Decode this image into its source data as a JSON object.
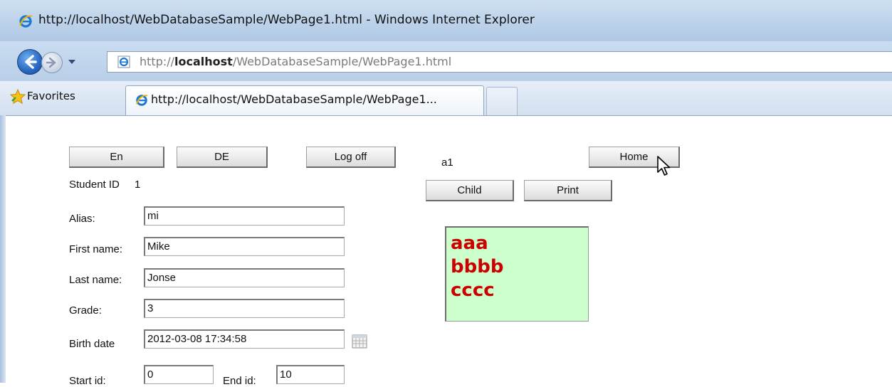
{
  "window": {
    "title": "http://localhost/WebDatabaseSample/WebPage1.html - Windows Internet Explorer"
  },
  "address_bar": {
    "prefix": "http://",
    "host": "localhost",
    "path": "/WebDatabaseSample/WebPage1.html"
  },
  "favorites": {
    "label": "Favorites"
  },
  "tab": {
    "label": "http://localhost/WebDatabaseSample/WebPage1..."
  },
  "buttons": {
    "en": "En",
    "de": "DE",
    "logoff": "Log off",
    "home": "Home",
    "child": "Child",
    "print": "Print"
  },
  "user_label": "a1",
  "student": {
    "id_label": "Student ID",
    "id_value": "1"
  },
  "form": {
    "alias_label": "Alias:",
    "alias_value": "mi",
    "firstname_label": "First name:",
    "firstname_value": "Mike",
    "lastname_label": "Last name:",
    "lastname_value": "Jonse",
    "grade_label": "Grade:",
    "grade_value": "3",
    "birthdate_label": "Birth date",
    "birthdate_value": "2012-03-08 17:34:58",
    "startid_label": "Start id:",
    "startid_value": "0",
    "endid_label": "End id:",
    "endid_value": "10"
  },
  "list": {
    "items": [
      "aaa",
      "bbbb",
      "cccc"
    ]
  },
  "icons": {
    "ie": "internet-explorer-icon",
    "back": "back-arrow-icon",
    "forward": "forward-arrow-icon",
    "star": "star-icon",
    "calendar": "calendar-icon",
    "cursor": "mouse-pointer-icon"
  },
  "colors": {
    "list_background": "#ccffcc",
    "list_text": "#cc0000",
    "chrome": "#bcd2ea"
  }
}
